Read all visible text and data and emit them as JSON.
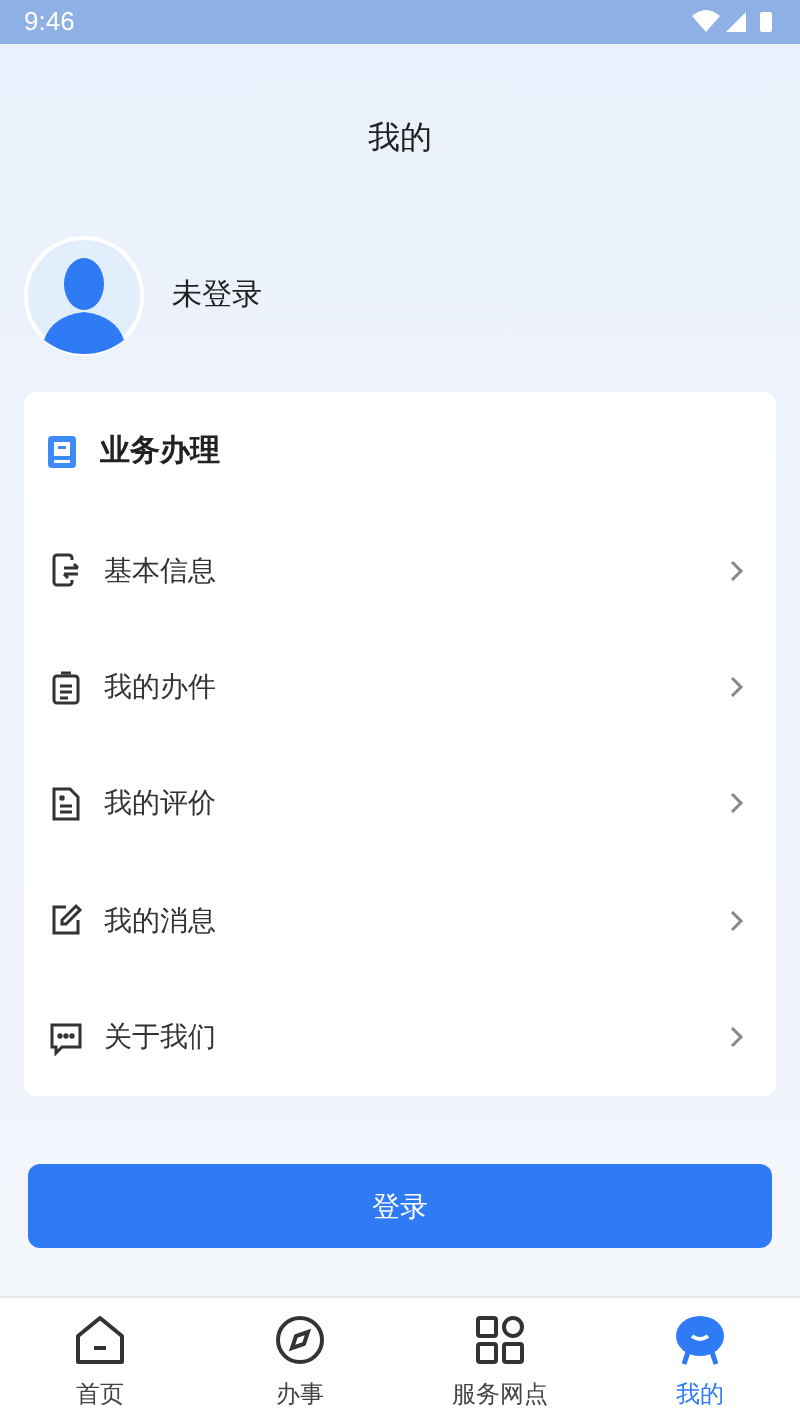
{
  "status_bar": {
    "time": "9:46"
  },
  "header": {
    "title": "我的"
  },
  "profile": {
    "name": "未登录"
  },
  "card": {
    "title": "业务办理",
    "items": [
      {
        "label": "基本信息",
        "kind": "info"
      },
      {
        "label": "我的办件",
        "kind": "clipboard"
      },
      {
        "label": "我的评价",
        "kind": "document"
      },
      {
        "label": "我的消息",
        "kind": "edit"
      },
      {
        "label": "关于我们",
        "kind": "chat"
      }
    ]
  },
  "login_button": "登录",
  "tabs": [
    {
      "label": "首页",
      "kind": "home",
      "selected": false
    },
    {
      "label": "办事",
      "kind": "compass",
      "selected": false
    },
    {
      "label": "服务网点",
      "kind": "grid",
      "selected": false
    },
    {
      "label": "我的",
      "kind": "mine",
      "selected": true
    }
  ]
}
